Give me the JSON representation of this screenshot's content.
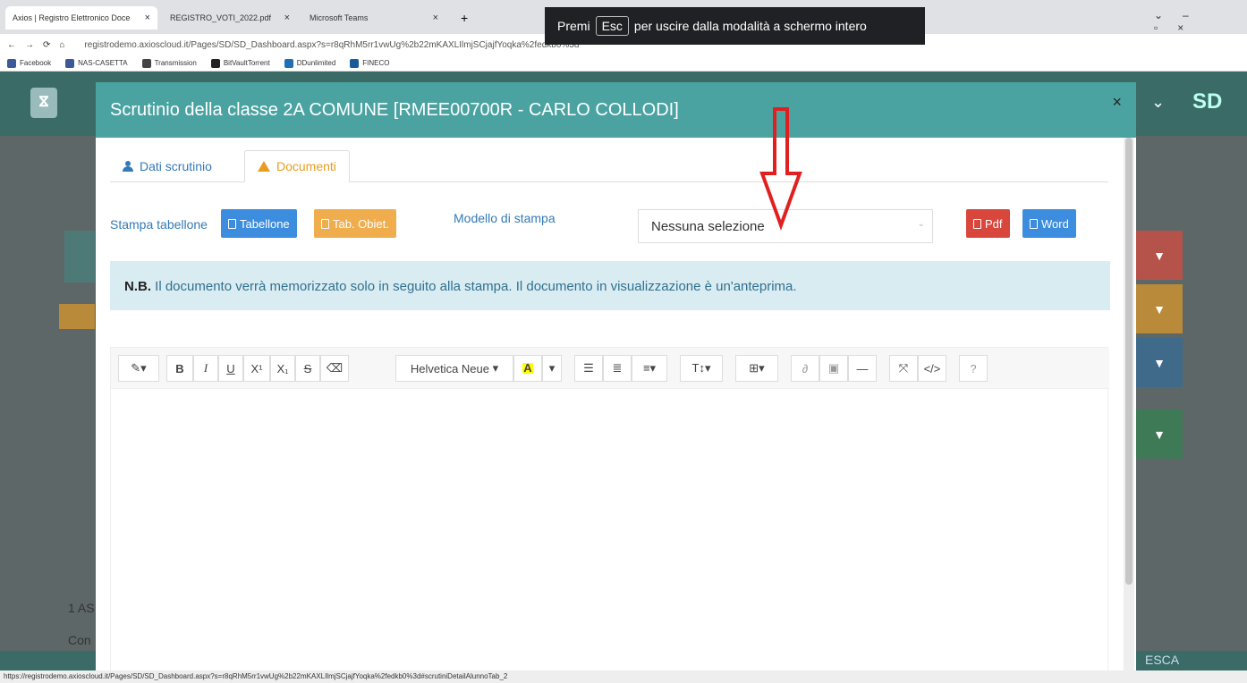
{
  "browser": {
    "tabs": [
      {
        "title": "Axios | Registro Elettronico Doce"
      },
      {
        "title": "REGISTRO_VOTI_2022.pdf"
      },
      {
        "title": "Microsoft Teams"
      }
    ],
    "url": "registrodemo.axioscloud.it/Pages/SD/SD_Dashboard.aspx?s=r8qRhM5rr1vwUg%2b22mKAXLIlmjSCjajfYoqka%2fedkb0%3d",
    "bookmarks": [
      "Facebook",
      "NAS-CASETTA",
      "Transmission",
      "BitVaultTorrent",
      "DDunlimited",
      "FINECO"
    ],
    "fullscreen_banner": {
      "premi": "Premi",
      "key": "Esc",
      "text": "per uscire dalla modalità a schermo intero"
    },
    "status_url": "https://registrodemo.axioscloud.it/Pages/SD/SD_Dashboard.aspx?s=r8qRhM5rr1vwUg%2b22mKAXLIlmjSCjajfYoqka%2fedkb0%3d#scrutiniDetailAlunnoTab_2"
  },
  "background": {
    "sd_label": "SD",
    "left_text_1": "1 AS",
    "left_text_2": "Con",
    "bottom_right": "ESCA"
  },
  "modal": {
    "title": "Scrutinio della classe 2A COMUNE [RMEE00700R - CARLO COLLODI]",
    "close": "×",
    "tabs": [
      {
        "label": "Dati scrutinio",
        "active": false
      },
      {
        "label": "Documenti",
        "active": true
      }
    ],
    "stampa_tabellone_label": "Stampa tabellone",
    "btn_tabellone": "Tabellone",
    "btn_tab_obiet": "Tab. Obiet.",
    "modello_label": "Modello di stampa",
    "select_value": "Nessuna selezione",
    "btn_pdf": "Pdf",
    "btn_word": "Word",
    "nb_bold": "N.B.",
    "nb_text": " Il documento verrà memorizzato solo in seguito alla stampa. Il documento in visualizzazione è un'anteprima.",
    "editor_toolbar": {
      "font_name": "Helvetica Neue",
      "bold": "B",
      "italic": "I",
      "underline": "U",
      "superscript": "X¹",
      "subscript": "X₁",
      "strikethrough": "S",
      "color": "A"
    }
  },
  "colors": {
    "header": "#4aa3a1",
    "btn_blue": "#3c8dde",
    "btn_orange": "#f0ad4e",
    "btn_red": "#d9463b",
    "arrow": "#e02020"
  }
}
